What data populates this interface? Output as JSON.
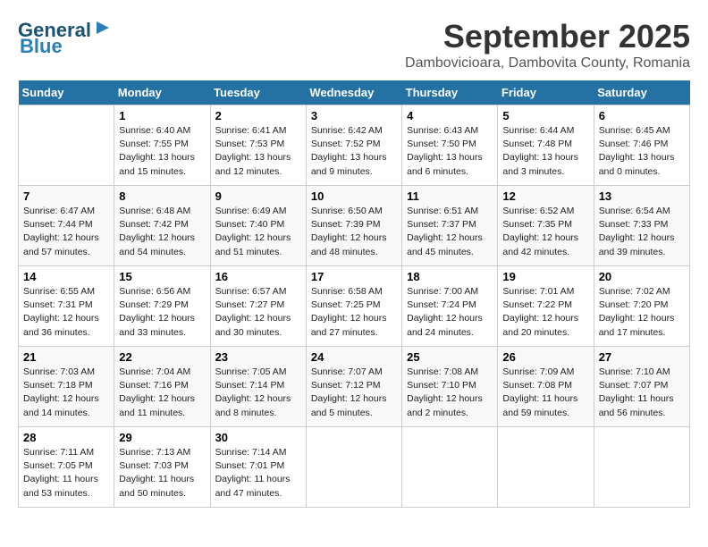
{
  "header": {
    "logo_general": "General",
    "logo_blue": "Blue",
    "month_year": "September 2025",
    "location": "Dambovicioara, Dambovita County, Romania"
  },
  "days_of_week": [
    "Sunday",
    "Monday",
    "Tuesday",
    "Wednesday",
    "Thursday",
    "Friday",
    "Saturday"
  ],
  "weeks": [
    [
      {
        "num": "",
        "text": ""
      },
      {
        "num": "1",
        "text": "Sunrise: 6:40 AM\nSunset: 7:55 PM\nDaylight: 13 hours\nand 15 minutes."
      },
      {
        "num": "2",
        "text": "Sunrise: 6:41 AM\nSunset: 7:53 PM\nDaylight: 13 hours\nand 12 minutes."
      },
      {
        "num": "3",
        "text": "Sunrise: 6:42 AM\nSunset: 7:52 PM\nDaylight: 13 hours\nand 9 minutes."
      },
      {
        "num": "4",
        "text": "Sunrise: 6:43 AM\nSunset: 7:50 PM\nDaylight: 13 hours\nand 6 minutes."
      },
      {
        "num": "5",
        "text": "Sunrise: 6:44 AM\nSunset: 7:48 PM\nDaylight: 13 hours\nand 3 minutes."
      },
      {
        "num": "6",
        "text": "Sunrise: 6:45 AM\nSunset: 7:46 PM\nDaylight: 13 hours\nand 0 minutes."
      }
    ],
    [
      {
        "num": "7",
        "text": "Sunrise: 6:47 AM\nSunset: 7:44 PM\nDaylight: 12 hours\nand 57 minutes."
      },
      {
        "num": "8",
        "text": "Sunrise: 6:48 AM\nSunset: 7:42 PM\nDaylight: 12 hours\nand 54 minutes."
      },
      {
        "num": "9",
        "text": "Sunrise: 6:49 AM\nSunset: 7:40 PM\nDaylight: 12 hours\nand 51 minutes."
      },
      {
        "num": "10",
        "text": "Sunrise: 6:50 AM\nSunset: 7:39 PM\nDaylight: 12 hours\nand 48 minutes."
      },
      {
        "num": "11",
        "text": "Sunrise: 6:51 AM\nSunset: 7:37 PM\nDaylight: 12 hours\nand 45 minutes."
      },
      {
        "num": "12",
        "text": "Sunrise: 6:52 AM\nSunset: 7:35 PM\nDaylight: 12 hours\nand 42 minutes."
      },
      {
        "num": "13",
        "text": "Sunrise: 6:54 AM\nSunset: 7:33 PM\nDaylight: 12 hours\nand 39 minutes."
      }
    ],
    [
      {
        "num": "14",
        "text": "Sunrise: 6:55 AM\nSunset: 7:31 PM\nDaylight: 12 hours\nand 36 minutes."
      },
      {
        "num": "15",
        "text": "Sunrise: 6:56 AM\nSunset: 7:29 PM\nDaylight: 12 hours\nand 33 minutes."
      },
      {
        "num": "16",
        "text": "Sunrise: 6:57 AM\nSunset: 7:27 PM\nDaylight: 12 hours\nand 30 minutes."
      },
      {
        "num": "17",
        "text": "Sunrise: 6:58 AM\nSunset: 7:25 PM\nDaylight: 12 hours\nand 27 minutes."
      },
      {
        "num": "18",
        "text": "Sunrise: 7:00 AM\nSunset: 7:24 PM\nDaylight: 12 hours\nand 24 minutes."
      },
      {
        "num": "19",
        "text": "Sunrise: 7:01 AM\nSunset: 7:22 PM\nDaylight: 12 hours\nand 20 minutes."
      },
      {
        "num": "20",
        "text": "Sunrise: 7:02 AM\nSunset: 7:20 PM\nDaylight: 12 hours\nand 17 minutes."
      }
    ],
    [
      {
        "num": "21",
        "text": "Sunrise: 7:03 AM\nSunset: 7:18 PM\nDaylight: 12 hours\nand 14 minutes."
      },
      {
        "num": "22",
        "text": "Sunrise: 7:04 AM\nSunset: 7:16 PM\nDaylight: 12 hours\nand 11 minutes."
      },
      {
        "num": "23",
        "text": "Sunrise: 7:05 AM\nSunset: 7:14 PM\nDaylight: 12 hours\nand 8 minutes."
      },
      {
        "num": "24",
        "text": "Sunrise: 7:07 AM\nSunset: 7:12 PM\nDaylight: 12 hours\nand 5 minutes."
      },
      {
        "num": "25",
        "text": "Sunrise: 7:08 AM\nSunset: 7:10 PM\nDaylight: 12 hours\nand 2 minutes."
      },
      {
        "num": "26",
        "text": "Sunrise: 7:09 AM\nSunset: 7:08 PM\nDaylight: 11 hours\nand 59 minutes."
      },
      {
        "num": "27",
        "text": "Sunrise: 7:10 AM\nSunset: 7:07 PM\nDaylight: 11 hours\nand 56 minutes."
      }
    ],
    [
      {
        "num": "28",
        "text": "Sunrise: 7:11 AM\nSunset: 7:05 PM\nDaylight: 11 hours\nand 53 minutes."
      },
      {
        "num": "29",
        "text": "Sunrise: 7:13 AM\nSunset: 7:03 PM\nDaylight: 11 hours\nand 50 minutes."
      },
      {
        "num": "30",
        "text": "Sunrise: 7:14 AM\nSunset: 7:01 PM\nDaylight: 11 hours\nand 47 minutes."
      },
      {
        "num": "",
        "text": ""
      },
      {
        "num": "",
        "text": ""
      },
      {
        "num": "",
        "text": ""
      },
      {
        "num": "",
        "text": ""
      }
    ]
  ]
}
